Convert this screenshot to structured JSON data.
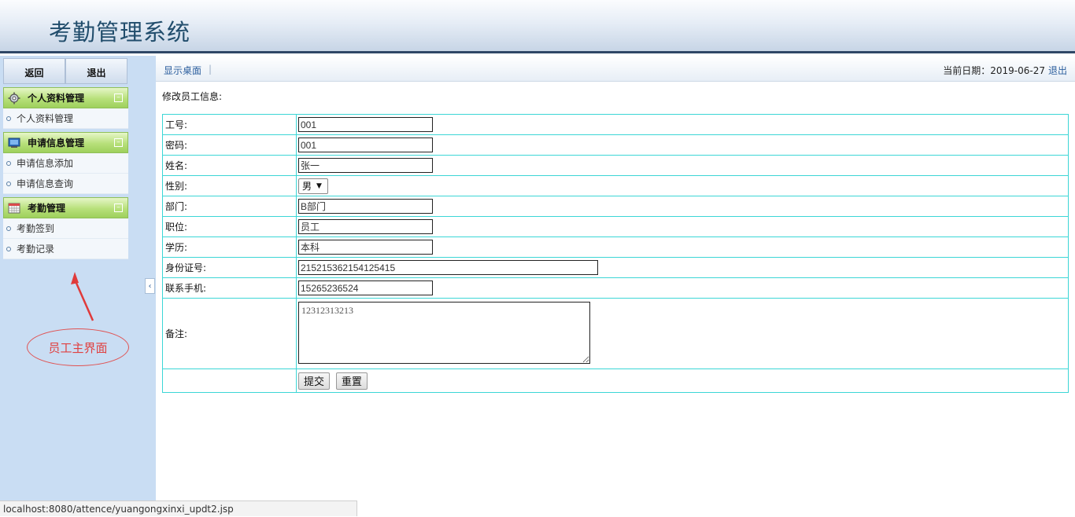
{
  "header": {
    "title": "考勤管理系统"
  },
  "sidebar": {
    "buttons": {
      "back": "返回",
      "exit": "退出"
    },
    "groups": [
      {
        "label": "个人资料管理",
        "icon": "gear-icon",
        "items": [
          "个人资料管理"
        ]
      },
      {
        "label": "申请信息管理",
        "icon": "monitor-icon",
        "items": [
          "申请信息添加",
          "申请信息查询"
        ]
      },
      {
        "label": "考勤管理",
        "icon": "calendar-icon",
        "items": [
          "考勤签到",
          "考勤记录"
        ]
      }
    ]
  },
  "annotation": {
    "text": "员工主界面",
    "color": "#e04040"
  },
  "topbar": {
    "home": "显示桌面",
    "date_label": "当前日期：2019-06-27",
    "logout": "退出"
  },
  "form": {
    "title": "修改员工信息:",
    "fields": {
      "id": {
        "label": "工号:",
        "value": "001"
      },
      "password": {
        "label": "密码:",
        "value": "001"
      },
      "name": {
        "label": "姓名:",
        "value": "张一"
      },
      "gender": {
        "label": "性别:",
        "value": "男"
      },
      "dept": {
        "label": "部门:",
        "value": "B部门"
      },
      "position": {
        "label": "职位:",
        "value": "员工"
      },
      "education": {
        "label": "学历:",
        "value": "本科"
      },
      "idcard": {
        "label": "身份证号:",
        "value": "215215362154125415"
      },
      "phone": {
        "label": "联系手机:",
        "value": "15265236524"
      },
      "remark": {
        "label": "备注:",
        "value": "12312313213"
      }
    },
    "buttons": {
      "submit": "提交",
      "reset": "重置"
    }
  },
  "statusbar": {
    "url": "localhost:8080/attence/yuangongxinxi_updt2.jsp"
  },
  "colors": {
    "border": "#3cd6d6",
    "header_bar": "#2f4766",
    "link": "#2d5f9e"
  }
}
